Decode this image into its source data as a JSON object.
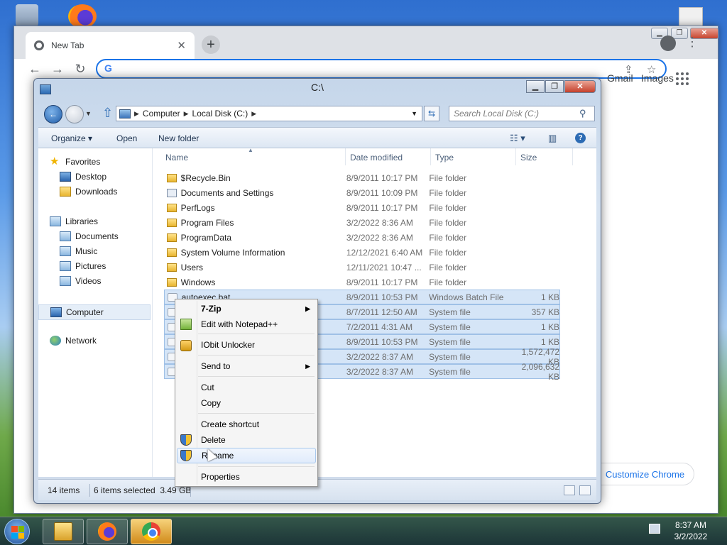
{
  "chrome": {
    "tab_title": "New Tab",
    "omnibox_value": "",
    "links": [
      "Gmail",
      "Images"
    ],
    "customize_label": "Customize Chrome"
  },
  "explorer": {
    "title": "C:\\",
    "breadcrumb": [
      "Computer",
      "Local Disk (C:)"
    ],
    "search_placeholder": "Search Local Disk (C:)",
    "toolbar": {
      "organize": "Organize",
      "open": "Open",
      "new_folder": "New folder"
    },
    "nav": {
      "favorites": "Favorites",
      "favorites_items": [
        "Desktop",
        "Downloads"
      ],
      "libraries": "Libraries",
      "libraries_items": [
        "Documents",
        "Music",
        "Pictures",
        "Videos"
      ],
      "computer": "Computer",
      "network": "Network"
    },
    "columns": [
      "Name",
      "Date modified",
      "Type",
      "Size"
    ],
    "files": [
      {
        "name": "$Recycle.Bin",
        "date": "8/9/2011 10:17 PM",
        "type": "File folder",
        "size": ""
      },
      {
        "name": "Documents and Settings",
        "date": "8/9/2011 10:09 PM",
        "type": "File folder",
        "size": ""
      },
      {
        "name": "PerfLogs",
        "date": "8/9/2011 10:17 PM",
        "type": "File folder",
        "size": ""
      },
      {
        "name": "Program Files",
        "date": "3/2/2022 8:36 AM",
        "type": "File folder",
        "size": ""
      },
      {
        "name": "ProgramData",
        "date": "3/2/2022 8:36 AM",
        "type": "File folder",
        "size": ""
      },
      {
        "name": "System Volume Information",
        "date": "12/12/2021 6:40 AM",
        "type": "File folder",
        "size": ""
      },
      {
        "name": "Users",
        "date": "12/11/2021 10:47 ...",
        "type": "File folder",
        "size": ""
      },
      {
        "name": "Windows",
        "date": "8/9/2011 10:17 PM",
        "type": "File folder",
        "size": ""
      },
      {
        "name": "autoexec.bat",
        "date": "8/9/2011 10:53 PM",
        "type": "Windows Batch File",
        "size": "1 KB"
      },
      {
        "name": "",
        "date": "8/7/2011 12:50 AM",
        "type": "System file",
        "size": "357 KB"
      },
      {
        "name": "",
        "date": "7/2/2011 4:31 AM",
        "type": "System file",
        "size": "1 KB"
      },
      {
        "name": "",
        "date": "8/9/2011 10:53 PM",
        "type": "System file",
        "size": "1 KB"
      },
      {
        "name": "",
        "date": "3/2/2022 8:37 AM",
        "type": "System file",
        "size": "1,572,472 KB"
      },
      {
        "name": "",
        "date": "3/2/2022 8:37 AM",
        "type": "System file",
        "size": "2,096,632 KB"
      }
    ],
    "status": {
      "count": "14 items",
      "selected": "6 items selected  3.49 GB"
    }
  },
  "context_menu": {
    "items": [
      "7-Zip",
      "Edit with Notepad++",
      "IObit Unlocker",
      "Send to",
      "Cut",
      "Copy",
      "Create shortcut",
      "Delete",
      "Rename",
      "Properties"
    ]
  },
  "taskbar": {
    "time": "8:37 AM",
    "date": "3/2/2022"
  },
  "colors": {
    "accent": "#1a73e8",
    "selection": "#d5e5f7"
  }
}
